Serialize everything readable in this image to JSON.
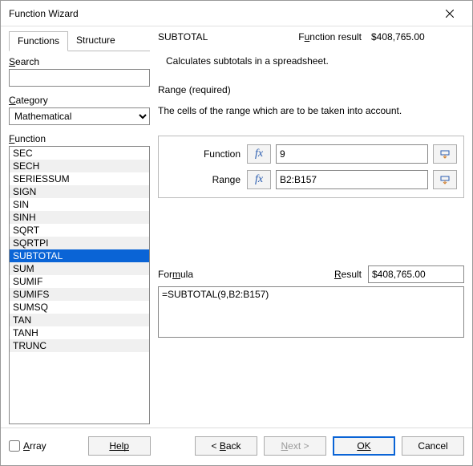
{
  "window": {
    "title": "Function Wizard"
  },
  "tabs": {
    "functions": "Functions",
    "structure": "Structure"
  },
  "left": {
    "search_label": "Search",
    "search_value": "",
    "category_label": "Category",
    "category_selected": "Mathematical",
    "function_label": "Function",
    "functions": [
      "SEC",
      "SECH",
      "SERIESSUM",
      "SIGN",
      "SIN",
      "SINH",
      "SQRT",
      "SQRTPI",
      "SUBTOTAL",
      "SUM",
      "SUMIF",
      "SUMIFS",
      "SUMSQ",
      "TAN",
      "TANH",
      "TRUNC"
    ],
    "selected_function": "SUBTOTAL"
  },
  "right": {
    "fn_name": "SUBTOTAL",
    "fn_result_label": "Function result",
    "fn_result_value": "$408,765.00",
    "description": "Calculates subtotals in a spreadsheet.",
    "arg_heading": "Range (required)",
    "arg_description": "The cells of the range which are to be taken into account.",
    "args": {
      "function_label": "Function",
      "function_value": "9",
      "range_label": "Range",
      "range_value": "B2:B157"
    },
    "formula_label": "Formula",
    "result_label": "Result",
    "result_value": "$408,765.00",
    "formula_value": "=SUBTOTAL(9,B2:B157)"
  },
  "bottom": {
    "array_label": "Array",
    "help": "Help",
    "back": "< Back",
    "next": "Next >",
    "ok": "OK",
    "cancel": "Cancel"
  },
  "icons": {
    "fx": "fx"
  }
}
